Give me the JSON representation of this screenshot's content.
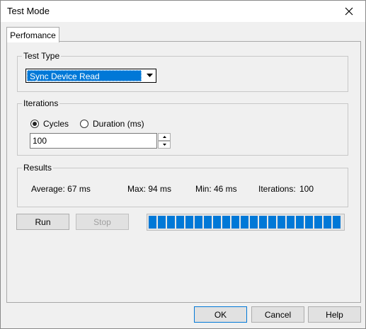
{
  "window": {
    "title": "Test Mode"
  },
  "tabs": [
    {
      "label": "Perfomance"
    }
  ],
  "test_type": {
    "legend": "Test Type",
    "selected": "Sync Device Read"
  },
  "iterations": {
    "legend": "Iterations",
    "options": [
      {
        "label": "Cycles",
        "checked": true
      },
      {
        "label": "Duration (ms)",
        "checked": false
      }
    ],
    "value": "100"
  },
  "results": {
    "legend": "Results",
    "average": "Average:  67 ms",
    "max": "Max:  94 ms",
    "min": "Min:  46 ms",
    "iterations_label": "Iterations:",
    "iterations_value": "100"
  },
  "actions": {
    "run": "Run",
    "stop": "Stop"
  },
  "progress": {
    "fraction": 1.0
  },
  "dialog_buttons": {
    "ok": "OK",
    "cancel": "Cancel",
    "help": "Help"
  },
  "colors": {
    "accent": "#0078d7"
  },
  "icons": {
    "close": "close-icon",
    "dropdown": "chevron-down-icon",
    "spin_up": "chevron-up-icon",
    "spin_down": "chevron-down-icon"
  }
}
